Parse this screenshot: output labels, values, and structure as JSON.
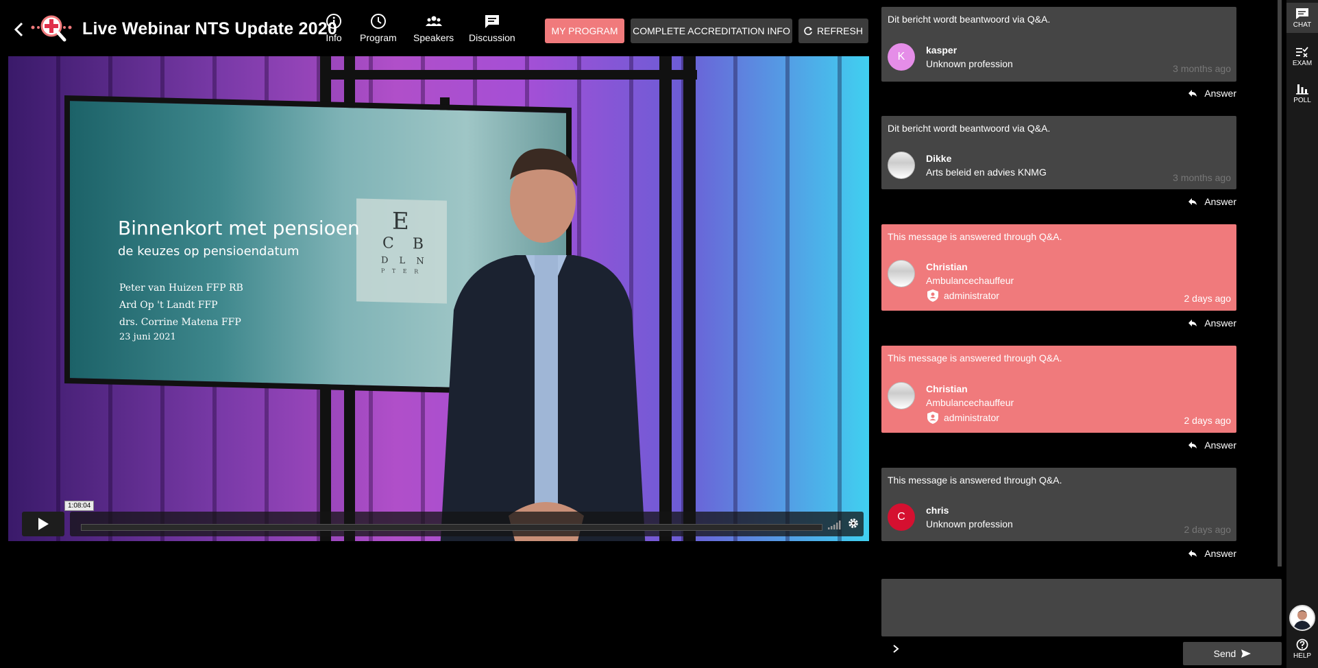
{
  "header": {
    "title": "Live Webinar NTS Update 2020",
    "nav": [
      {
        "label": "Info",
        "icon": "info-icon"
      },
      {
        "label": "Program",
        "icon": "clock-icon"
      },
      {
        "label": "Speakers",
        "icon": "people-icon"
      },
      {
        "label": "Discussion",
        "icon": "chat-bubble-icon"
      }
    ],
    "buttons": {
      "program": "MY PROGRAM",
      "accreditation": "COMPLETE ACCREDITATION INFO",
      "refresh": "REFRESH"
    },
    "colors": {
      "accent": "#f07a7c",
      "dark_button": "#3c3c3c"
    }
  },
  "video": {
    "slide": {
      "eye_chart": [
        "E",
        "C B",
        "D L N",
        "P T E R"
      ],
      "title": "Binnenkort met pensioen",
      "subtitle": "de keuzes op pensioendatum",
      "presenters": [
        "Peter van Huizen FFP RB",
        "Ard Op 't Landt FFP",
        "drs. Corrine Matena FFP"
      ],
      "date": "23 juni 2021"
    },
    "controls": {
      "time_tooltip": "1:08:04",
      "progress": 0.0
    }
  },
  "chat": {
    "messages": [
      {
        "intro": "Dit bericht wordt beantwoord via Q&A.",
        "user": "kasper",
        "avatar_letter": "K",
        "profession": "Unknown profession",
        "role": "",
        "time": "3 months ago",
        "style": "gray"
      },
      {
        "intro": "Dit bericht wordt beantwoord via Q&A.",
        "user": "Dikke",
        "avatar_letter": "",
        "profession": "Arts beleid en advies KNMG",
        "role": "",
        "time": "3 months ago",
        "style": "gray"
      },
      {
        "intro": "This message is answered through Q&A.",
        "user": "Christian",
        "avatar_letter": "",
        "profession": "Ambulancechauffeur",
        "role": "administrator",
        "time": "2 days ago",
        "style": "red"
      },
      {
        "intro": "This message is answered through Q&A.",
        "user": "Christian",
        "avatar_letter": "",
        "profession": "Ambulancechauffeur",
        "role": "administrator",
        "time": "2 days ago",
        "style": "red"
      },
      {
        "intro": "This message is answered through Q&A.",
        "user": "chris",
        "avatar_letter": "C",
        "profession": "Unknown profession",
        "role": "",
        "time": "2 days ago",
        "style": "gray"
      }
    ],
    "answer_label": "Answer",
    "send_label": "Send",
    "composer_value": ""
  },
  "rail": {
    "items": [
      {
        "label": "CHAT",
        "icon": "chat-icon",
        "active": true
      },
      {
        "label": "EXAM",
        "icon": "exam-checklist-icon",
        "active": false
      },
      {
        "label": "POLL",
        "icon": "poll-bar-chart-icon",
        "active": false
      }
    ],
    "help_label": "HELP"
  }
}
